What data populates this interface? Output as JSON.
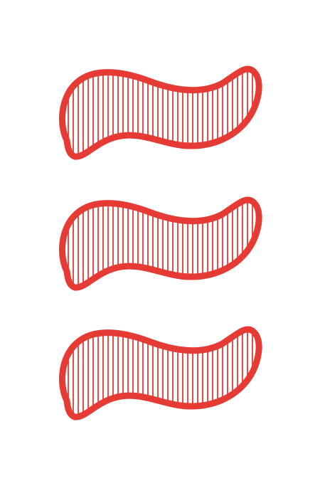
{
  "card": {
    "count": 3,
    "shape": "squiggle",
    "shading": "striped",
    "color": "red",
    "color_hex": "#e63a34",
    "background_hex": "#ffffff"
  }
}
